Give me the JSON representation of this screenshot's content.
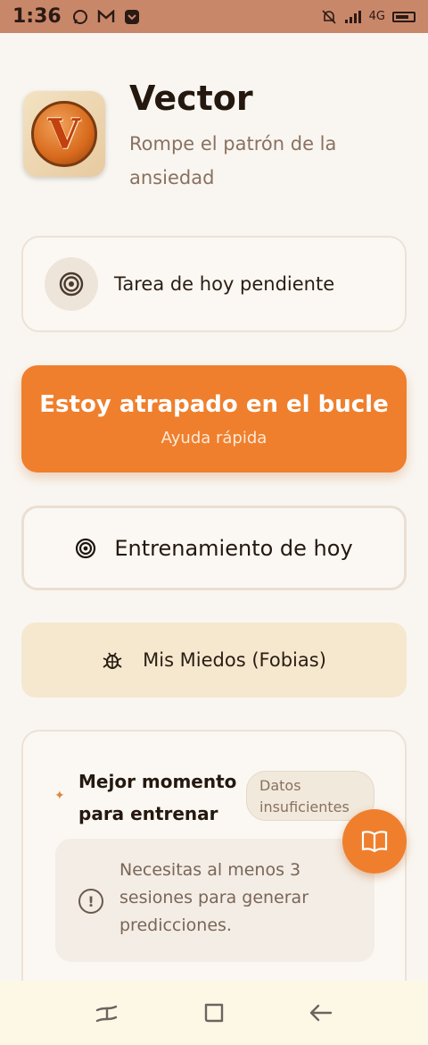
{
  "status_bar": {
    "time": "1:36",
    "icons": [
      "whatsapp-icon",
      "gmail-icon",
      "pocket-icon",
      "mute-icon",
      "signal-icon",
      "battery-icon"
    ],
    "network": "4G"
  },
  "header": {
    "logo_letter": "V",
    "title": "Vector",
    "subtitle": "Rompe el patrón de la ansiedad"
  },
  "task_card": {
    "label": "Tarea de hoy pendiente",
    "icon": "target-icon"
  },
  "stuck_button": {
    "title": "Estoy atrapado en el bucle",
    "subtitle": "Ayuda rápida"
  },
  "training_button": {
    "label": "Entrenamiento de hoy",
    "icon": "target-icon"
  },
  "fears_button": {
    "label": "Mis Miedos (Fobias)",
    "icon": "bug-icon"
  },
  "moment_card": {
    "title": "Mejor momento para entrenar",
    "badge": "Datos insuficientes",
    "info_text": "Necesitas al menos 3 sesiones para generar predicciones.",
    "info_icon": "!"
  },
  "fab": {
    "icon": "book-icon"
  },
  "nav": {
    "items": [
      "recents-icon",
      "home-icon",
      "back-icon"
    ]
  },
  "colors": {
    "accent": "#ef7f2d",
    "background": "#f9f6f1",
    "status_bar": "#c9876a"
  }
}
